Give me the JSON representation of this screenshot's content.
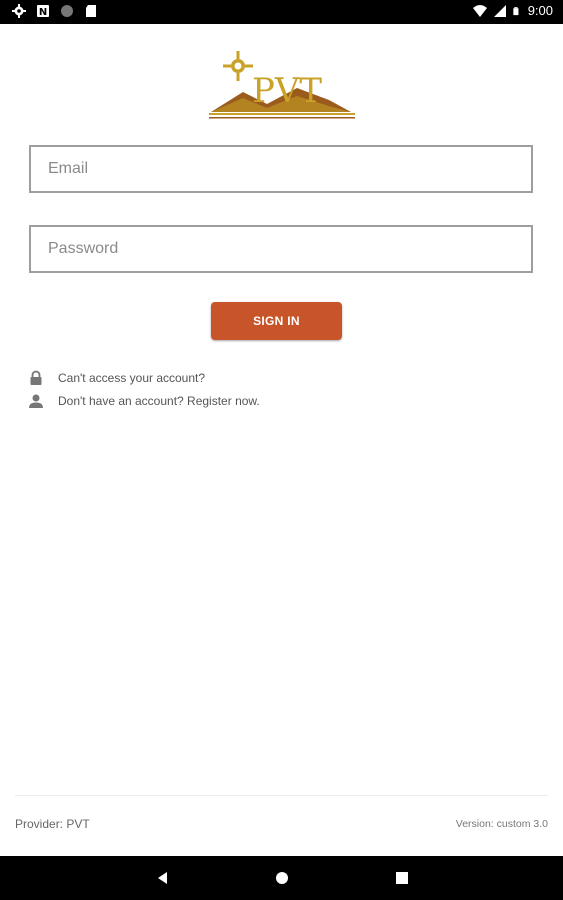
{
  "status_bar": {
    "time": "9:00",
    "left_icons": [
      "gear-icon",
      "notification-icon",
      "record-icon",
      "sd-card-icon"
    ],
    "right_icons": [
      "wifi-icon",
      "signal-icon",
      "battery-icon"
    ]
  },
  "logo": {
    "text": "PVT",
    "colors": {
      "gold": "#c9a227",
      "brown": "#9a5b1c"
    }
  },
  "login": {
    "email_placeholder": "Email",
    "password_placeholder": "Password",
    "signin_label": "SIGN IN",
    "accent": "#c8552a"
  },
  "links": {
    "access": "Can't access your account?",
    "register": "Don't have an account? Register now."
  },
  "footer": {
    "provider": "Provider: PVT",
    "version": "Version: custom 3.0"
  },
  "nav": [
    "back-icon",
    "home-icon",
    "recents-icon"
  ]
}
